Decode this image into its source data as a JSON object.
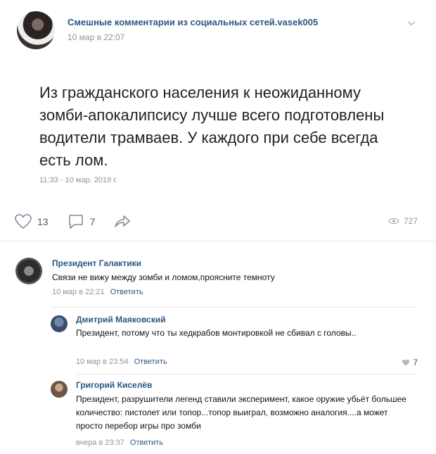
{
  "post": {
    "group_name": "Смешные комментарии из социальных сетей.vasek005",
    "date": "10 мар в 22:07",
    "text": "Из гражданского населения к неожиданному зомби-апокалипсису лучше всего подготовлены водители трамваев. У каждого при себе всегда есть лом.",
    "time": "11:33 - 10 мар. 2019 г.",
    "likes": "13",
    "comments": "7",
    "views": "727"
  },
  "comments": [
    {
      "author": "Президент Галактики",
      "text": "Связи не вижу между зомби и ломом,проясните темноту",
      "date": "10 мар в 22:21",
      "reply": "Ответить"
    },
    {
      "author": "Дмитрий Маяковский",
      "text": "Президент, потому что ты хедкрабов монтировкой не сбивал с головы..",
      "date": "10 мар в 23:54",
      "reply": "Ответить",
      "likes": "7"
    },
    {
      "author": "Григорий Киселёв",
      "text": "Президент, разрушители легенд ставили эксперимент, какое оружие убьёт большее количество: пистолет или топор...топор выиграл, возможно аналогия....а может просто перебор игры про зомби",
      "date": "вчера в 23:37",
      "reply": "Ответить"
    }
  ]
}
